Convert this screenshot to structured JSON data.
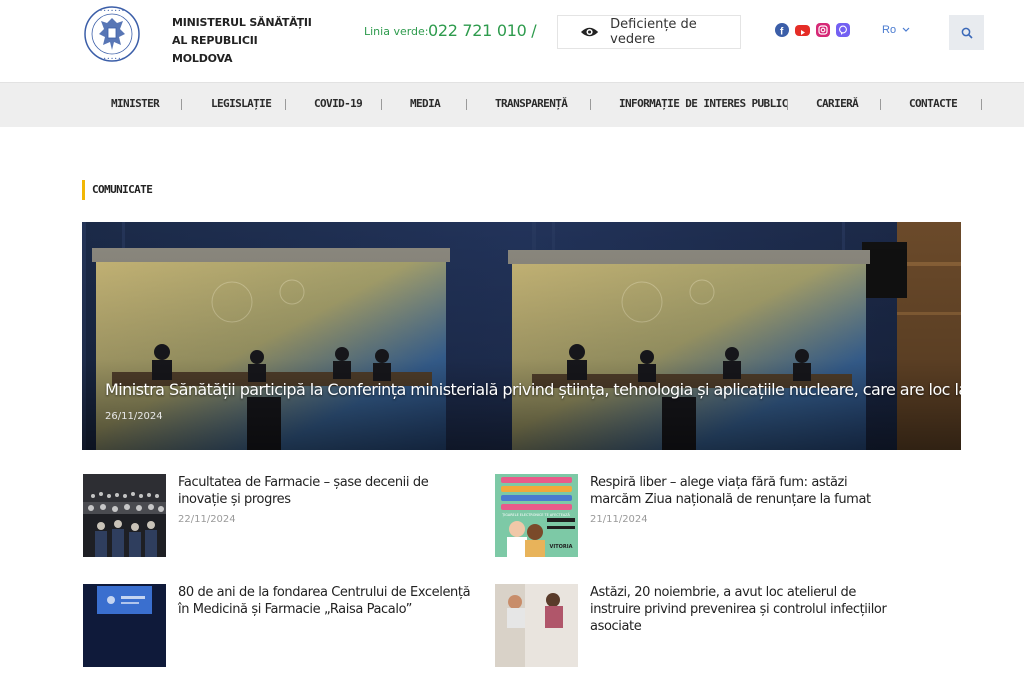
{
  "header": {
    "ministry_name": "MINISTERUL SĂNĂTĂȚII AL REPUBLICII MOLDOVA",
    "hotline_label": "Linia verde:",
    "hotline_number": "022 721 010 /",
    "vision_button": "Deficiențe de vedere",
    "language": "Ro",
    "socials": [
      "facebook-icon",
      "youtube-icon",
      "instagram-icon",
      "viber-icon"
    ]
  },
  "nav": {
    "items": [
      "MINISTER",
      "LEGISLAȚIE",
      "COVID-19",
      "MEDIA",
      "TRANSPARENȚĂ",
      "INFORMAȚIE DE INTERES PUBLIC",
      "CARIERĂ",
      "CONTACTE"
    ]
  },
  "section": {
    "title": "COMUNICATE"
  },
  "featured": {
    "title": "Ministra Sănătății participă la Conferința ministerială privind știința, tehnologia și aplicațiile nucleare, care are loc la Vie...",
    "date": "26/11/2024"
  },
  "news": [
    {
      "title": "Facultatea de Farmacie – șase decenii de inovație și progres",
      "date": "22/11/2024"
    },
    {
      "title": "Respiră liber – alege viața fără fum: astăzi marcăm Ziua națională de renunțare la fumat",
      "date": "21/11/2024"
    },
    {
      "title": "80 de ani de la fondarea Centrului de Excelență în Medicină și Farmacie „Raisa Pacalo”",
      "date": ""
    },
    {
      "title": "Astăzi, 20 noiembrie, a avut loc atelierul de instruire privind prevenirea și controlul infecțiilor asociate",
      "date": ""
    }
  ],
  "thumb_texts": {
    "smoking_heading": "ȚIGARELE ELECTRONICE TE AFECTEAZĂ",
    "smoking_word": "VITORIA"
  },
  "colors": {
    "accent_green": "#2e9b4d",
    "accent_yellow": "#f2b705",
    "nav_bg": "#eeeeee",
    "link_blue": "#4a7bd0"
  }
}
